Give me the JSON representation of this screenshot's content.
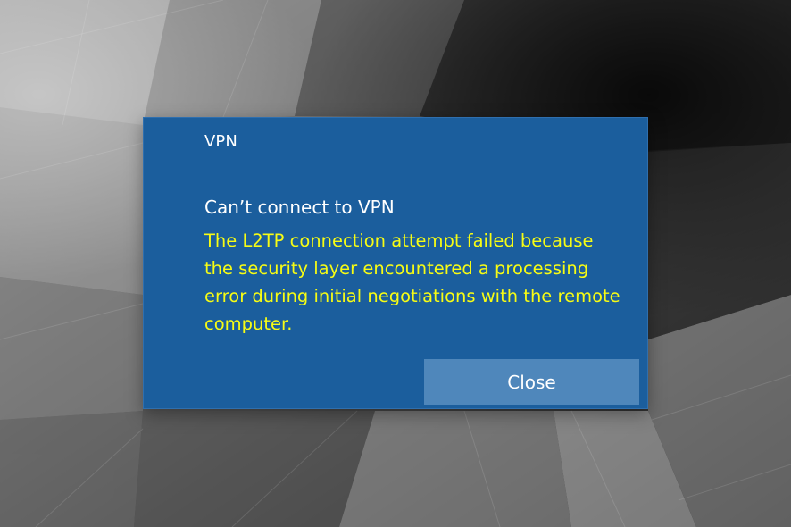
{
  "colors": {
    "dialog_background": "#1b5e9d",
    "dialog_text": "#ffffff",
    "message_text": "#f7fc14",
    "close_button_background": "#4f87bb",
    "close_button_text": "#ffffff"
  },
  "dialog": {
    "title": "VPN",
    "heading": "Can’t connect to VPN",
    "message": "The L2TP connection attempt failed because the security layer encountered a processing error during initial negotiations with the remote computer.",
    "close_label": "Close"
  }
}
